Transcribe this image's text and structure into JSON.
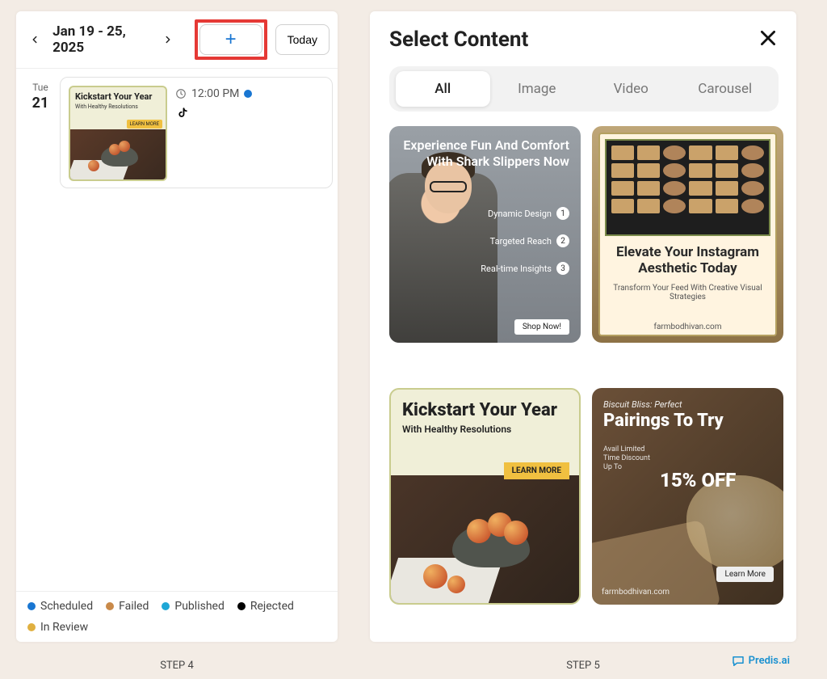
{
  "calendar": {
    "date_range": "Jan 19 - 25, 2025",
    "today_label": "Today",
    "day_name": "Tue",
    "day_number": "21",
    "event": {
      "time": "12:00 PM",
      "thumb_title": "Kickstart Your Year",
      "thumb_subtitle": "With Healthy Resolutions",
      "thumb_button": "LEARN MORE"
    }
  },
  "legend": {
    "scheduled": "Scheduled",
    "failed": "Failed",
    "published": "Published",
    "rejected": "Rejected",
    "in_review": "In Review"
  },
  "colors": {
    "scheduled": "#1976d2",
    "failed": "#c98a4a",
    "published": "#1ea7d6",
    "rejected": "#000000",
    "in_review": "#e0b040"
  },
  "content_picker": {
    "title": "Select Content",
    "tabs": {
      "all": "All",
      "image": "Image",
      "video": "Video",
      "carousel": "Carousel"
    },
    "cards": {
      "c1": {
        "headline": "Experience Fun And Comfort With Shark Slippers Now",
        "b1": "Dynamic Design",
        "b2": "Targeted Reach",
        "b3": "Real-time Insights",
        "cta": "Shop Now!"
      },
      "c2": {
        "headline": "Elevate Your Instagram Aesthetic Today",
        "sub": "Transform Your Feed With Creative Visual Strategies",
        "url": "farmbodhivan.com"
      },
      "c3": {
        "headline": "Kickstart Your Year",
        "sub": "With Healthy Resolutions",
        "cta": "LEARN MORE"
      },
      "c4": {
        "kicker": "Biscuit Bliss: Perfect",
        "headline": "Pairings To Try",
        "badge": "Avail Limited Time Discount Up To",
        "discount": "15% OFF",
        "cta": "Learn More",
        "url": "farmbodhivan.com"
      }
    }
  },
  "footer": {
    "step4": "STEP 4",
    "step5": "STEP 5",
    "brand": "Predis.ai"
  }
}
